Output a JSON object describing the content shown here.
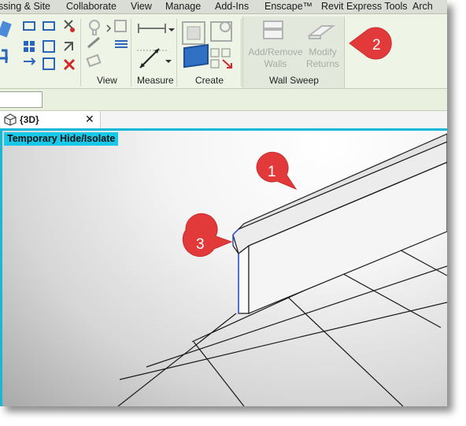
{
  "menu": {
    "tabs": [
      "ssing & Site",
      "Collaborate",
      "View",
      "Manage",
      "Add-Ins",
      "Enscape™",
      "Revit Express Tools",
      "Arch"
    ]
  },
  "ribbon": {
    "panels": {
      "view_label": "View",
      "measure_label": "Measure",
      "create_label": "Create",
      "wall_sweep_label": "Wall Sweep"
    },
    "wall_sweep": {
      "add_remove_line1": "Add/Remove",
      "add_remove_line2": "Walls",
      "modify_line1": "Modify",
      "modify_line2": "Returns"
    }
  },
  "view_tab": {
    "label": "{3D}",
    "close": "✕"
  },
  "viewport": {
    "mode_badge": "Temporary Hide/Isolate"
  },
  "callouts": {
    "one": "1",
    "two": "2",
    "three": "3"
  },
  "colors": {
    "accent_cyan": "#18c8e8",
    "callout_red": "#e23a3a",
    "ribbon_bg": "#eef4e6"
  }
}
